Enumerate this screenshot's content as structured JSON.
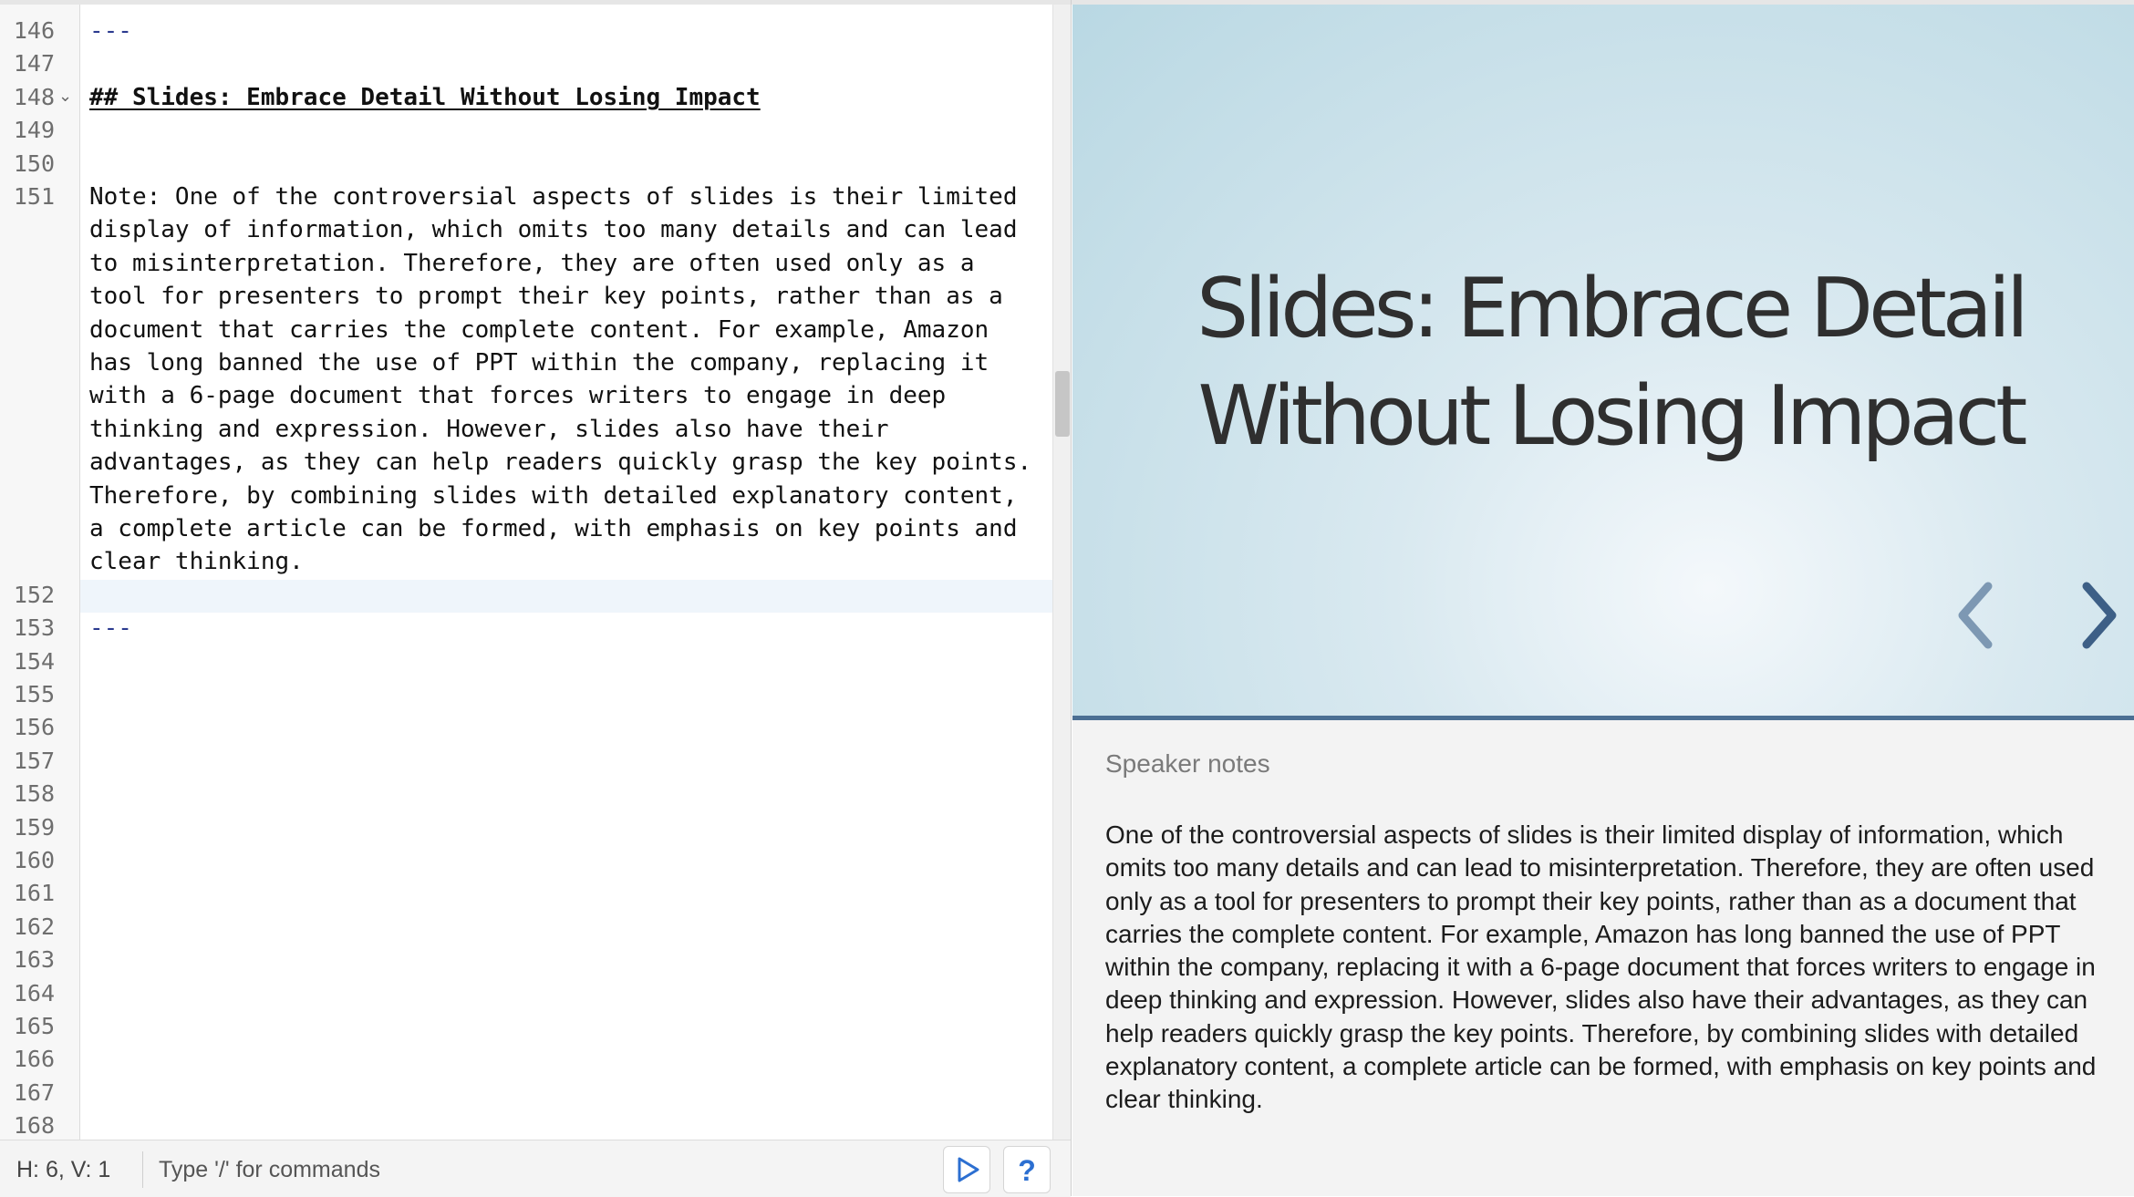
{
  "editor": {
    "line_numbers": [
      "146",
      "147",
      "148",
      "149",
      "150",
      "151",
      "152",
      "153",
      "154",
      "155",
      "156",
      "157",
      "158",
      "159",
      "160",
      "161",
      "162",
      "163",
      "164",
      "165",
      "166",
      "167",
      "168"
    ],
    "fold_marker": "⌄",
    "hr_top": "---",
    "heading": "## Slides: Embrace Detail Without Losing Impact",
    "note_lines": [
      "Note: One of the controversial aspects of slides is their limited",
      "display of information, which omits too many details and can lead",
      "to misinterpretation. Therefore, they are often used only as a",
      "tool for presenters to prompt their key points, rather than as a",
      "document that carries the complete content. For example, Amazon",
      "has long banned the use of PPT within the company, replacing it",
      "with a 6-page document that forces writers to engage in deep",
      "thinking and expression. However, slides also have their",
      "advantages, as they can help readers quickly grasp the key points.",
      "Therefore, by combining slides with detailed explanatory content,",
      "a complete article can be formed, with emphasis on key points and",
      "clear thinking."
    ],
    "hr_bottom": "---"
  },
  "statusbar": {
    "position": "H: 6, V: 1",
    "command_hint": "Type '/' for commands",
    "play_icon": "play-icon",
    "help_label": "?"
  },
  "slide": {
    "title_line1": "Slides: Embrace Detail",
    "title_line2": "Without Losing Impact",
    "prev_icon": "chevron-left-icon",
    "next_icon": "chevron-right-icon"
  },
  "notes": {
    "label": "Speaker notes",
    "text": "One of the controversial aspects of slides is their limited display of information, which omits too many details and can lead to misinterpretation. Therefore, they are often used only as a tool for presenters to prompt their key points, rather than as a document that carries the complete content. For example, Amazon has long banned the use of PPT within the company, replacing it with a 6-page document that forces writers to engage in deep thinking and expression. However, slides also have their advantages, as they can help readers quickly grasp the key points. Therefore, by combining slides with detailed explanatory content, a complete article can be formed, with emphasis on key points and clear thinking."
  },
  "colors": {
    "accent": "#4b6f93",
    "hr_marker": "#2b3a8f",
    "help_blue": "#2c6fd1"
  }
}
